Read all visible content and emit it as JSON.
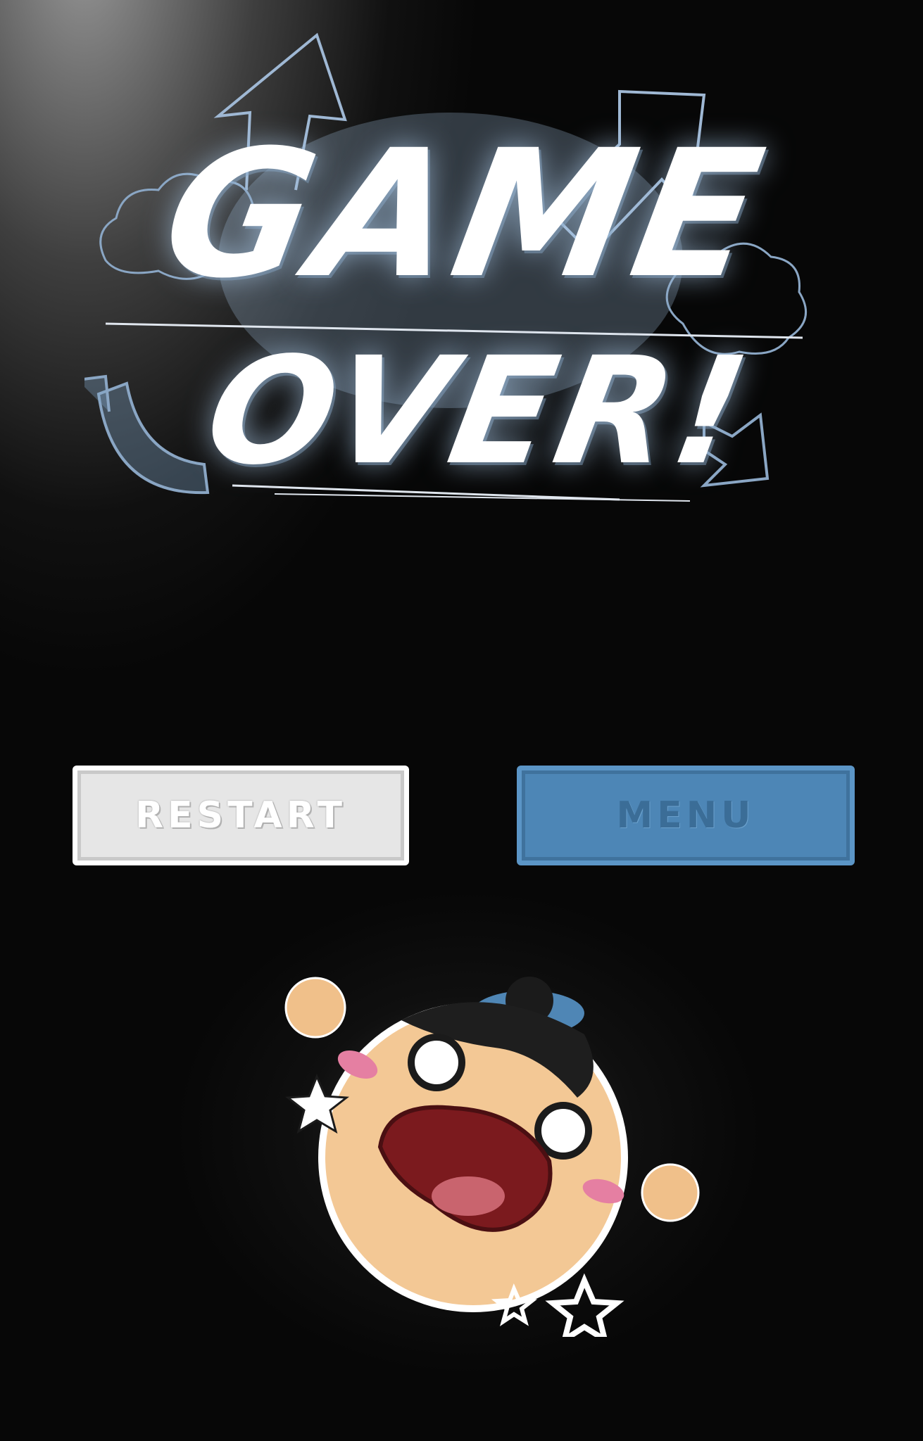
{
  "title": {
    "line1": "GAME",
    "line2": "OVER!"
  },
  "buttons": {
    "restart_label": "RESTART",
    "menu_label": "MENU"
  },
  "colors": {
    "background": "#070707",
    "title_text": "#ffffff",
    "chalk_doodle": "#9fb8d4",
    "restart_button": "#e6e6e6",
    "menu_button": "#4d86b6",
    "character_face": "#f2c694",
    "character_mouth": "#7b1a1e"
  },
  "icons": [
    "chalk-arrow-icon",
    "cloud-doodle-icon",
    "star-icon"
  ]
}
